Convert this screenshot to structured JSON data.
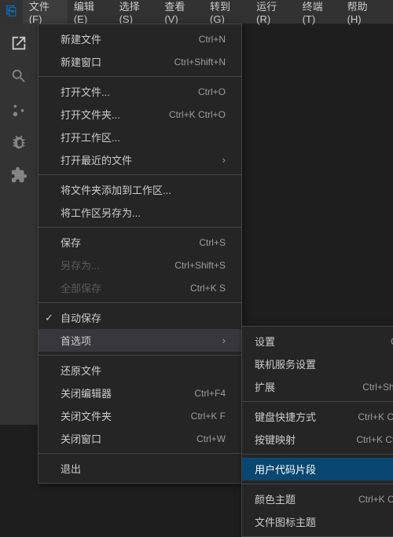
{
  "menubar": {
    "logo": "⊞",
    "items": [
      {
        "label": "文件(F)",
        "active": true
      },
      {
        "label": "编辑(E)"
      },
      {
        "label": "选择(S)"
      },
      {
        "label": "查看(V)"
      },
      {
        "label": "转到(G)"
      },
      {
        "label": "运行(R)"
      },
      {
        "label": "终端(T)"
      },
      {
        "label": "帮助(H)"
      }
    ]
  },
  "file_menu": {
    "items": [
      {
        "id": "new-file",
        "label": "新建文件",
        "shortcut": "Ctrl+N",
        "type": "item"
      },
      {
        "id": "new-window",
        "label": "新建窗口",
        "shortcut": "Ctrl+Shift+N",
        "type": "item"
      },
      {
        "type": "separator"
      },
      {
        "id": "open-file",
        "label": "打开文件...",
        "shortcut": "Ctrl+O",
        "type": "item"
      },
      {
        "id": "open-folder",
        "label": "打开文件夹...",
        "shortcut": "Ctrl+K Ctrl+O",
        "type": "item"
      },
      {
        "id": "open-workspace",
        "label": "打开工作区...",
        "type": "item"
      },
      {
        "id": "open-recent",
        "label": "打开最近的文件",
        "type": "item",
        "arrow": true
      },
      {
        "type": "separator"
      },
      {
        "id": "add-folder",
        "label": "将文件夹添加到工作区...",
        "type": "item"
      },
      {
        "id": "save-workspace",
        "label": "将工作区另存为...",
        "type": "item"
      },
      {
        "type": "separator"
      },
      {
        "id": "save",
        "label": "保存",
        "shortcut": "Ctrl+S",
        "type": "item"
      },
      {
        "id": "save-as",
        "label": "另存为...",
        "shortcut": "Ctrl+Shift+S",
        "type": "item",
        "disabled": true
      },
      {
        "id": "save-all",
        "label": "全部保存",
        "shortcut": "Ctrl+K S",
        "type": "item",
        "disabled": true
      },
      {
        "type": "separator"
      },
      {
        "id": "auto-save",
        "label": "自动保存",
        "type": "item",
        "check": true
      },
      {
        "id": "preferences",
        "label": "首选项",
        "type": "submenu",
        "arrow": true
      },
      {
        "type": "separator"
      },
      {
        "id": "revert-file",
        "label": "还原文件",
        "type": "item"
      },
      {
        "id": "close-editor",
        "label": "关闭编辑器",
        "shortcut": "Ctrl+F4",
        "type": "item"
      },
      {
        "id": "close-folder",
        "label": "关闭文件夹",
        "shortcut": "Ctrl+K F",
        "type": "item"
      },
      {
        "id": "close-window",
        "label": "关闭窗口",
        "shortcut": "Ctrl+W",
        "type": "item"
      },
      {
        "type": "separator"
      },
      {
        "id": "exit",
        "label": "退出",
        "type": "item"
      }
    ]
  },
  "preferences_submenu": {
    "items": [
      {
        "id": "settings",
        "label": "设置",
        "shortcut": "Ctrl+,",
        "type": "item"
      },
      {
        "id": "online-services",
        "label": "联机服务设置",
        "type": "item"
      },
      {
        "id": "extensions",
        "label": "扩展",
        "shortcut": "Ctrl+Shift+X",
        "type": "item"
      },
      {
        "type": "separator"
      },
      {
        "id": "keyboard-shortcuts",
        "label": "键盘快捷方式",
        "shortcut": "Ctrl+K Ctrl+S",
        "type": "item"
      },
      {
        "id": "keymaps",
        "label": "按键映射",
        "shortcut": "Ctrl+K Ctrl+M",
        "type": "item"
      },
      {
        "type": "separator"
      },
      {
        "id": "user-snippets",
        "label": "用户代码片段",
        "type": "item",
        "highlighted": true
      },
      {
        "type": "separator"
      },
      {
        "id": "color-theme",
        "label": "颜色主题",
        "shortcut": "Ctrl+K Ctrl+T",
        "type": "item"
      },
      {
        "id": "file-icon-theme",
        "label": "文件图标主题",
        "type": "item"
      }
    ]
  },
  "sidebar": {
    "icons": [
      {
        "id": "explorer",
        "symbol": "⬜",
        "active": true
      },
      {
        "id": "search",
        "symbol": "🔍"
      },
      {
        "id": "source-control",
        "symbol": "⑂"
      },
      {
        "id": "debug",
        "symbol": "▶"
      },
      {
        "id": "extensions",
        "symbol": "⊞"
      }
    ]
  }
}
